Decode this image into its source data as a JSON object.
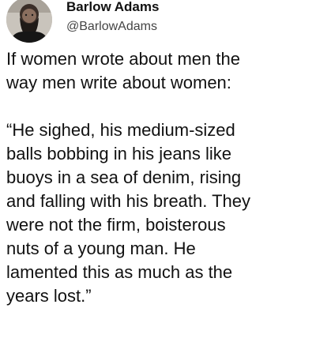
{
  "tweet": {
    "author": {
      "display_name": "Barlow Adams",
      "handle": "@BarlowAdams",
      "avatar_icon": "profile-photo-avatar"
    },
    "paragraph1": [
      "If women wrote about men the",
      "way men write about women:"
    ],
    "paragraph2": [
      "“He sighed, his medium-sized",
      "balls bobbing in his jeans like",
      "buoys in a sea of denim, rising",
      "and falling with his breath. They",
      "were not the firm, boisterous",
      "nuts of a young man. He",
      "lamented this as much as the",
      "years lost.”"
    ]
  }
}
